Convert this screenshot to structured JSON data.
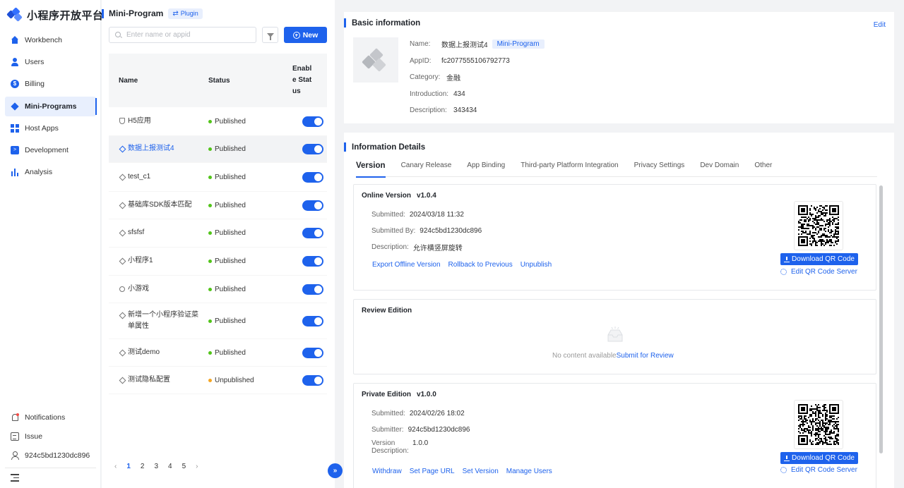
{
  "brand": {
    "name": "小程序开放平台"
  },
  "nav": {
    "items": [
      {
        "label": "Workbench",
        "icon": "home-icon"
      },
      {
        "label": "Users",
        "icon": "user-icon"
      },
      {
        "label": "Billing",
        "icon": "billing-icon"
      },
      {
        "label": "Mini-Programs",
        "icon": "diamond-icon",
        "active": true
      },
      {
        "label": "Host Apps",
        "icon": "grid-icon"
      },
      {
        "label": "Development",
        "icon": "terminal-icon"
      },
      {
        "label": "Analysis",
        "icon": "bar-chart-icon"
      }
    ],
    "bottom": [
      {
        "label": "Notifications",
        "icon": "bell-icon"
      },
      {
        "label": "Issue",
        "icon": "clipboard-icon"
      },
      {
        "label": "924c5bd1230dc896",
        "icon": "person-icon"
      }
    ]
  },
  "list": {
    "title": "Mini-Program",
    "badge": "Plugin",
    "search_placeholder": "Enter name or appid",
    "new_label": "New",
    "columns": {
      "name": "Name",
      "status": "Status",
      "enable": "Enable Status"
    },
    "rows": [
      {
        "name": "H5应用",
        "status": "Published",
        "enabled": true,
        "icon": "shield",
        "selected": false
      },
      {
        "name": "数据上报测试4",
        "status": "Published",
        "enabled": true,
        "icon": "diamond",
        "selected": true
      },
      {
        "name": "test_c1",
        "status": "Published",
        "enabled": true,
        "icon": "diamond",
        "selected": false
      },
      {
        "name": "基础库SDK版本匹配",
        "status": "Published",
        "enabled": true,
        "icon": "diamond",
        "selected": false
      },
      {
        "name": "sfsfsf",
        "status": "Published",
        "enabled": true,
        "icon": "diamond",
        "selected": false
      },
      {
        "name": "小程序1",
        "status": "Published",
        "enabled": true,
        "icon": "diamond",
        "selected": false
      },
      {
        "name": "小游戏",
        "status": "Published",
        "enabled": true,
        "icon": "game",
        "selected": false
      },
      {
        "name": "新增一个小程序验证菜单属性",
        "status": "Published",
        "enabled": true,
        "icon": "diamond",
        "selected": false
      },
      {
        "name": "测试demo",
        "status": "Published",
        "enabled": true,
        "icon": "diamond",
        "selected": false
      },
      {
        "name": "测试隐私配置",
        "status": "Unpublished",
        "enabled": true,
        "icon": "diamond",
        "selected": false
      }
    ],
    "pagination": {
      "prev": "‹",
      "next": "›",
      "pages": [
        "1",
        "2",
        "3",
        "4",
        "5"
      ],
      "current": "1"
    }
  },
  "basic": {
    "title": "Basic information",
    "edit": "Edit",
    "name_label": "Name:",
    "name": "数据上报测试4",
    "type_badge": "Mini-Program",
    "appid_label": "AppID:",
    "appid": "fc2077555106792773",
    "category_label": "Category:",
    "category": "金融",
    "intro_label": "Introduction:",
    "intro": "434",
    "desc_label": "Description:",
    "desc": "343434"
  },
  "details": {
    "title": "Information Details",
    "tabs": [
      "Version",
      "Canary Release",
      "App Binding",
      "Third-party Platform Integration",
      "Privacy Settings",
      "Dev Domain",
      "Other"
    ],
    "online": {
      "title": "Online Version",
      "version": "v1.0.4",
      "submitted_label": "Submitted:",
      "submitted": "2024/03/18 11:32",
      "by_label": "Submitted By:",
      "by": "924c5bd1230dc896",
      "desc_label": "Description:",
      "desc": "允许横竖屏旋转",
      "actions": [
        "Export Offline Version",
        "Rollback to Previous",
        "Unpublish"
      ],
      "download": "Download QR Code",
      "edit_qr": "Edit QR Code Server"
    },
    "review": {
      "title": "Review Edition",
      "empty": "No content available",
      "submit": "Submit for Review"
    },
    "private": {
      "title": "Private Edition",
      "version": "v1.0.0",
      "submitted_label": "Submitted:",
      "submitted": "2024/02/26 18:02",
      "submitter_label": "Submitter:",
      "submitter": "924c5bd1230dc896",
      "vdesc_label_1": "Version",
      "vdesc_label_2": "Description:",
      "vdesc": "1.0.0",
      "actions": [
        "Withdraw",
        "Set Page URL",
        "Set Version",
        "Manage Users"
      ],
      "download": "Download QR Code",
      "edit_qr": "Edit QR Code Server"
    }
  },
  "colors": {
    "accent": "#1e62ec",
    "published": "#52c41a",
    "unpublished": "#f5a623"
  }
}
